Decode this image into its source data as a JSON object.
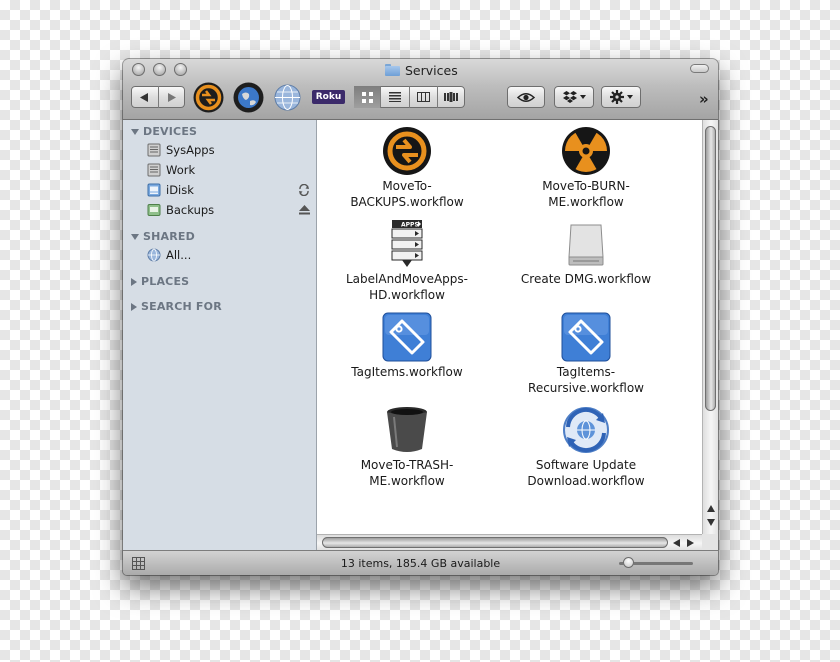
{
  "window": {
    "title": "Services"
  },
  "toolbar": {
    "back_icon": "back-arrow-icon",
    "forward_icon": "forward-arrow-icon",
    "roku_label": "Roku",
    "overflow_label": "»"
  },
  "sidebar": {
    "sections": [
      {
        "label": "DEVICES",
        "expanded": true
      },
      {
        "label": "SHARED",
        "expanded": true
      },
      {
        "label": "PLACES",
        "expanded": false
      },
      {
        "label": "SEARCH FOR",
        "expanded": false
      }
    ],
    "devices": [
      {
        "label": "SysApps"
      },
      {
        "label": "Work"
      },
      {
        "label": "iDisk"
      },
      {
        "label": "Backups"
      }
    ],
    "shared": [
      {
        "label": "All..."
      }
    ]
  },
  "files": [
    {
      "line1": "MoveTo-",
      "line2": "BACKUPS.workflow",
      "icon": "sync-arrows-icon"
    },
    {
      "line1": "MoveTo-BURN-",
      "line2": "ME.workflow",
      "icon": "radiation-icon"
    },
    {
      "line1": "LabelAndMoveApps-",
      "line2": "HD.workflow",
      "icon": "apps-list-icon",
      "badge": "APPS"
    },
    {
      "line1": "Create DMG.workflow",
      "line2": "",
      "icon": "disk-image-icon"
    },
    {
      "line1": "TagItems.workflow",
      "line2": "",
      "icon": "tag-icon"
    },
    {
      "line1": "TagItems-",
      "line2": "Recursive.workflow",
      "icon": "tag-icon"
    },
    {
      "line1": "MoveTo-TRASH-",
      "line2": "ME.workflow",
      "icon": "trash-icon"
    },
    {
      "line1": "Software Update",
      "line2": "Download.workflow",
      "icon": "software-update-icon"
    }
  ],
  "status": {
    "text": "13 items, 185.4 GB available"
  },
  "colors": {
    "accent_orange": "#e8901e",
    "sidebar_bg": "#d6dde5",
    "tag_blue": "#3f7fd6"
  }
}
